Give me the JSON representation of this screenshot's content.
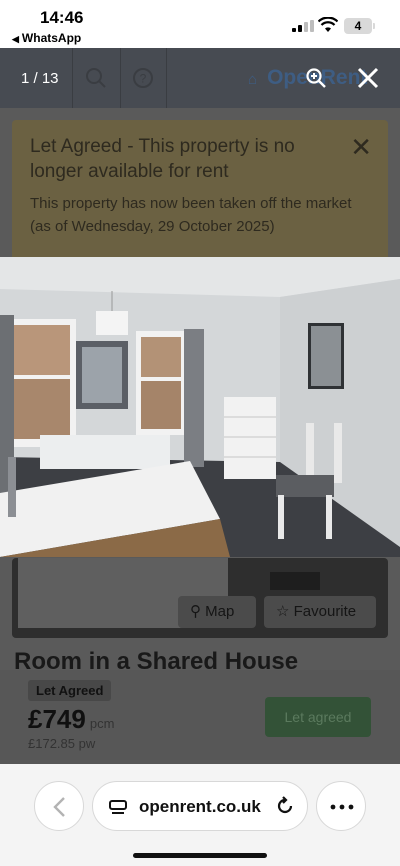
{
  "status": {
    "time": "14:46",
    "back_app": "WhatsApp",
    "battery": "4"
  },
  "gallery": {
    "counter": "1 / 13"
  },
  "page": {
    "brand": "OpenRent",
    "notice": {
      "title": "Let Agreed - This property is no longer available for rent",
      "body": "This property has now been taken off the market (as of Wednesday, 29 October 2025)"
    },
    "map_label": "Map",
    "favourite_label": "Favourite",
    "room_title": "Room in a Shared House",
    "badge": "Let Agreed",
    "price": "£749",
    "pcm": "pcm",
    "per_week": "£172.85 pw",
    "let_button": "Let agreed"
  },
  "browser": {
    "url": "openrent.co.uk"
  },
  "colors": {
    "notice_bg": "#6b6142",
    "brand": "#3e5d83",
    "let_button": "#335237"
  }
}
